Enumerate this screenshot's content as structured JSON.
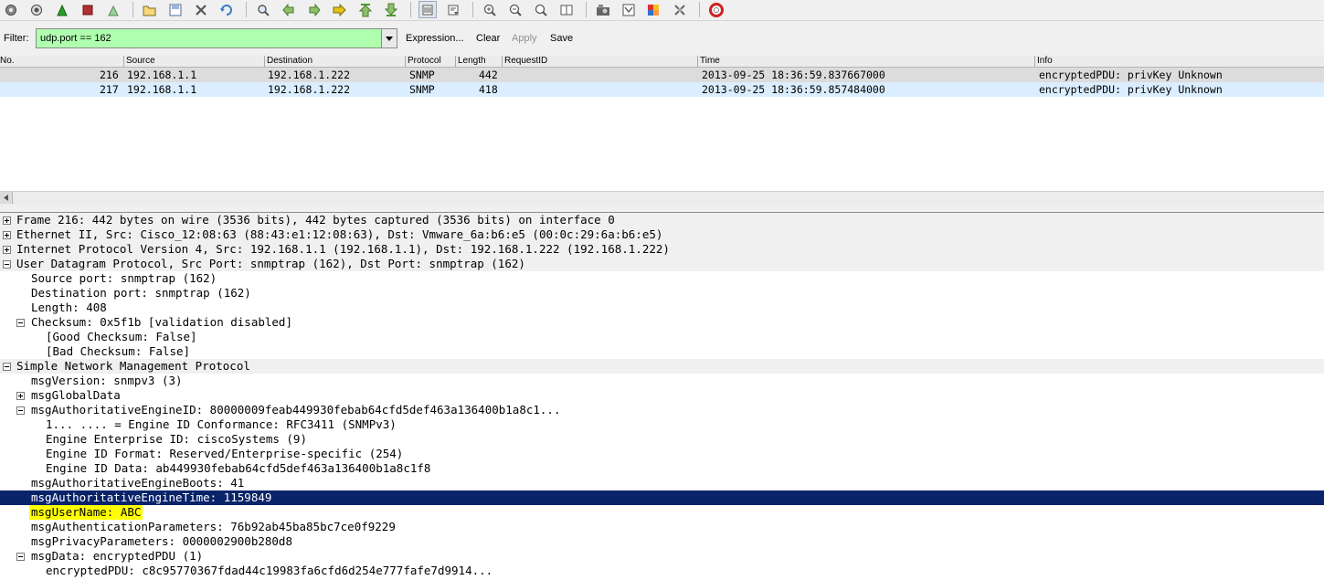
{
  "toolbar": {
    "icons": [
      "interface-list-icon",
      "capture-options-icon",
      "start-capture-icon",
      "stop-capture-icon",
      "restart-capture-icon",
      "open-file-icon",
      "save-file-icon",
      "close-file-icon",
      "reload-icon",
      "find-packet-icon",
      "go-back-icon",
      "go-forward-icon",
      "go-to-packet-icon",
      "go-first-icon",
      "go-last-icon",
      "colorize-icon",
      "auto-scroll-icon",
      "zoom-in-icon",
      "zoom-out-icon",
      "zoom-normal-icon",
      "resize-columns-icon",
      "capture-filters-icon",
      "display-filters-icon",
      "coloring-rules-icon",
      "preferences-icon",
      "help-icon"
    ]
  },
  "filter": {
    "label": "Filter:",
    "value": "udp.port == 162",
    "expression": "Expression...",
    "clear": "Clear",
    "apply": "Apply",
    "save": "Save",
    "box_color": "#afffaf"
  },
  "packet_list": {
    "columns": [
      "No.",
      "Source",
      "Destination",
      "Protocol",
      "Length",
      "RequestID",
      "Time",
      "Info"
    ],
    "rows": [
      {
        "no": "216",
        "source": "192.168.1.1",
        "destination": "192.168.1.222",
        "protocol": "SNMP",
        "length": "442",
        "requestid": "",
        "time": "2013-09-25 18:36:59.837667000",
        "info": "encryptedPDU: privKey Unknown",
        "color": "#dcdcdc"
      },
      {
        "no": "217",
        "source": "192.168.1.1",
        "destination": "192.168.1.222",
        "protocol": "SNMP",
        "length": "418",
        "requestid": "",
        "time": "2013-09-25 18:36:59.857484000",
        "info": "encryptedPDU: privKey Unknown",
        "color": "#daeeff"
      }
    ]
  },
  "details": {
    "lines": [
      {
        "text": "Frame 216: 442 bytes on wire (3536 bits), 442 bytes captured (3536 bits) on interface 0",
        "level": 0,
        "expander": "plus",
        "bg": "#f0f0f0"
      },
      {
        "text": "Ethernet II, Src: Cisco_12:08:63 (88:43:e1:12:08:63), Dst: Vmware_6a:b6:e5 (00:0c:29:6a:b6:e5)",
        "level": 0,
        "expander": "plus",
        "bg": "#f0f0f0"
      },
      {
        "text": "Internet Protocol Version 4, Src: 192.168.1.1 (192.168.1.1), Dst: 192.168.1.222 (192.168.1.222)",
        "level": 0,
        "expander": "plus",
        "bg": "#f0f0f0"
      },
      {
        "text": "User Datagram Protocol, Src Port: snmptrap (162), Dst Port: snmptrap (162)",
        "level": 0,
        "expander": "minus",
        "bg": "#f0f0f0"
      },
      {
        "text": "Source port: snmptrap (162)",
        "level": 1,
        "expander": "",
        "bg": ""
      },
      {
        "text": "Destination port: snmptrap (162)",
        "level": 1,
        "expander": "",
        "bg": ""
      },
      {
        "text": "Length: 408",
        "level": 1,
        "expander": "",
        "bg": ""
      },
      {
        "text": "Checksum: 0x5f1b [validation disabled]",
        "level": 1,
        "expander": "minus",
        "bg": ""
      },
      {
        "text": "[Good Checksum: False]",
        "level": 2,
        "expander": "",
        "bg": ""
      },
      {
        "text": "[Bad Checksum: False]",
        "level": 2,
        "expander": "",
        "bg": ""
      },
      {
        "text": "Simple Network Management Protocol",
        "level": 0,
        "expander": "minus",
        "bg": "#f0f0f0"
      },
      {
        "text": "msgVersion: snmpv3 (3)",
        "level": 1,
        "expander": "",
        "bg": ""
      },
      {
        "text": "msgGlobalData",
        "level": 1,
        "expander": "plus",
        "bg": ""
      },
      {
        "text": "msgAuthoritativeEngineID: 80000009feab449930febab64cfd5def463a136400b1a8c1...",
        "level": 1,
        "expander": "minus",
        "bg": ""
      },
      {
        "text": "1... .... = Engine ID Conformance: RFC3411 (SNMPv3)",
        "level": 2,
        "expander": "",
        "bg": ""
      },
      {
        "text": "Engine Enterprise ID: ciscoSystems (9)",
        "level": 2,
        "expander": "",
        "bg": ""
      },
      {
        "text": "Engine ID Format: Reserved/Enterprise-specific (254)",
        "level": 2,
        "expander": "",
        "bg": ""
      },
      {
        "text": "Engine ID Data: ab449930febab64cfd5def463a136400b1a8c1f8",
        "level": 2,
        "expander": "",
        "bg": ""
      },
      {
        "text": "msgAuthoritativeEngineBoots: 41",
        "level": 1,
        "expander": "",
        "bg": ""
      },
      {
        "text": "msgAuthoritativeEngineTime: 1159849",
        "level": 1,
        "expander": "",
        "bg": "#0a246a",
        "selected": true
      },
      {
        "text": "msgUserName: ABC",
        "level": 1,
        "expander": "",
        "bg": "",
        "highlight": "#ffff00"
      },
      {
        "text": "msgAuthenticationParameters: 76b92ab45ba85bc7ce0f9229",
        "level": 1,
        "expander": "",
        "bg": ""
      },
      {
        "text": "msgPrivacyParameters: 0000002900b280d8",
        "level": 1,
        "expander": "",
        "bg": ""
      },
      {
        "text": "msgData: encryptedPDU (1)",
        "level": 1,
        "expander": "minus",
        "bg": ""
      },
      {
        "text": "encryptedPDU: c8c95770367fdad44c19983fa6cfd6d254e777fafe7d9914...",
        "level": 2,
        "expander": "",
        "bg": ""
      }
    ]
  }
}
